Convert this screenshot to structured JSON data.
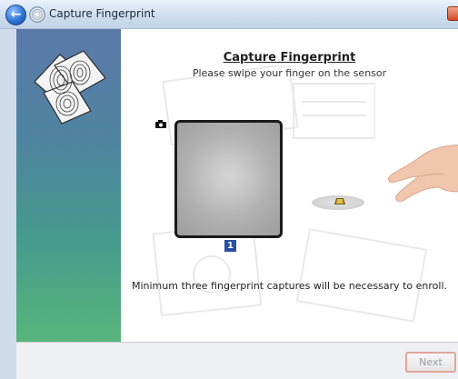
{
  "window": {
    "title": "Capture Fingerprint"
  },
  "main": {
    "heading": "Capture Fingerprint",
    "subheading": "Please swipe your finger on the sensor",
    "capture_count": "1",
    "info": "Minimum three fingerprint captures will be necessary to enroll."
  },
  "footer": {
    "next_label": "Next"
  },
  "icons": {
    "back": "back-arrow-icon",
    "app": "fingerprint-icon",
    "close": "close-icon",
    "camera": "camera-icon"
  },
  "colors": {
    "counter_badge": "#2a4fa3",
    "next_border": "#e2a59a",
    "back_button": "#2a6fd0"
  }
}
